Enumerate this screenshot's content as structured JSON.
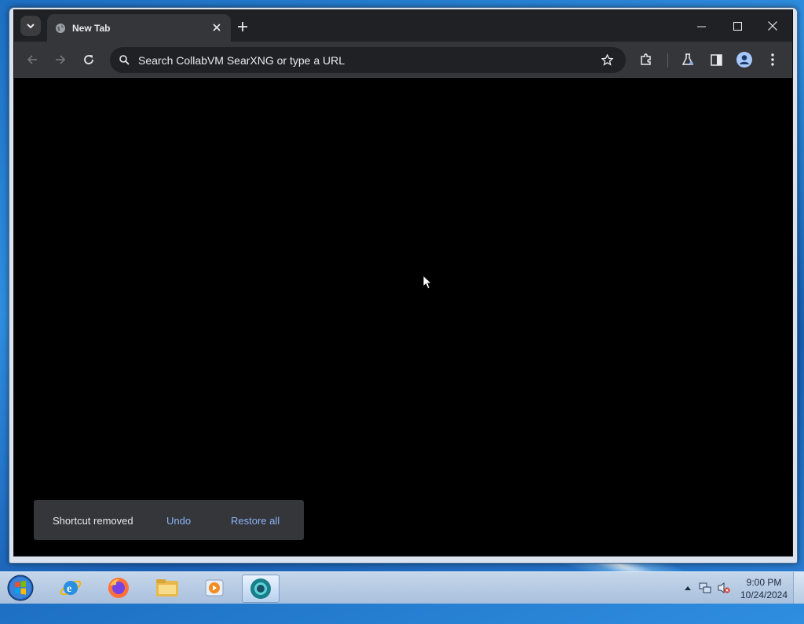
{
  "browser": {
    "tab": {
      "title": "New Tab",
      "favicon": "globe-icon"
    },
    "omnibox": {
      "placeholder": "Search CollabVM SearXNG or type a URL"
    }
  },
  "toast": {
    "message": "Shortcut removed",
    "undo_label": "Undo",
    "restore_label": "Restore all"
  },
  "taskbar": {
    "apps": [
      "internet-explorer-icon",
      "firefox-icon",
      "file-explorer-icon",
      "media-player-icon",
      "chrome-canary-icon"
    ],
    "clock": {
      "time": "9:00 PM",
      "date": "10/24/2024"
    }
  },
  "colors": {
    "accent": "#8ab4f8",
    "toolbar": "#35363a",
    "frame": "#202124"
  }
}
